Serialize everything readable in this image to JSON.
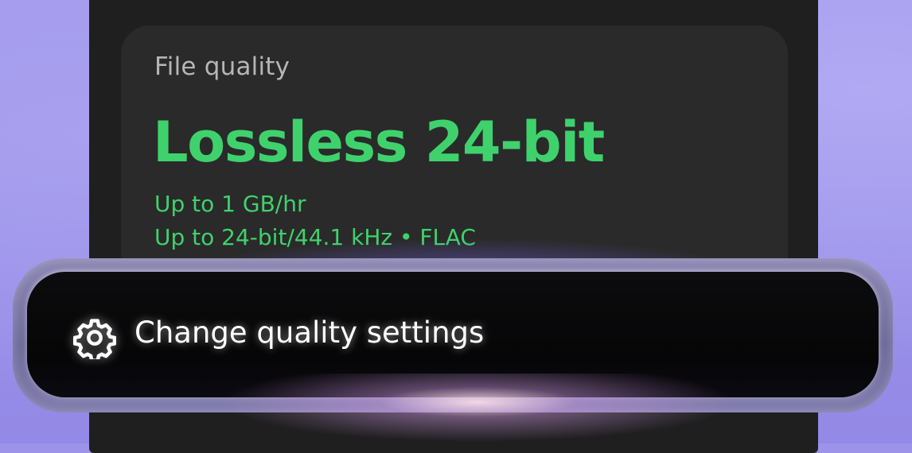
{
  "card": {
    "label": "File quality",
    "title": "Lossless 24-bit",
    "details": [
      "Up to 1 GB/hr",
      "Up to 24-bit/44.1 kHz • FLAC"
    ]
  },
  "action": {
    "icon": "gear-icon",
    "label": "Change quality settings"
  },
  "colors": {
    "accent": "#3fd26c",
    "background": "#9d94ea",
    "panel": "#1f1f1f",
    "card": "#2a2a2a",
    "pill": "#0a0a0b"
  }
}
